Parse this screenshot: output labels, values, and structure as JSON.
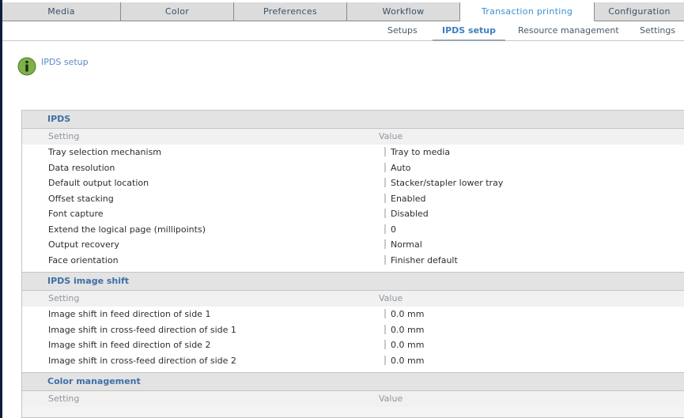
{
  "tabs": [
    "Media",
    "Color",
    "Preferences",
    "Workflow",
    "Transaction printing",
    "Configuration"
  ],
  "active_tab": "Transaction printing",
  "subtabs": [
    "Setups",
    "IPDS setup",
    "Resource management",
    "Settings"
  ],
  "active_subtab": "IPDS setup",
  "page_title": "IPDS setup",
  "sections": [
    {
      "title": "IPDS",
      "col_setting": "Setting",
      "col_value": "Value",
      "rows": [
        {
          "setting": "Tray selection mechanism",
          "value": "Tray to media"
        },
        {
          "setting": "Data resolution",
          "value": "Auto"
        },
        {
          "setting": "Default output location",
          "value": "Stacker/stapler lower tray"
        },
        {
          "setting": "Offset stacking",
          "value": "Enabled"
        },
        {
          "setting": "Font capture",
          "value": "Disabled"
        },
        {
          "setting": "Extend the logical page (millipoints)",
          "value": "0"
        },
        {
          "setting": "Output recovery",
          "value": "Normal"
        },
        {
          "setting": "Face orientation",
          "value": "Finisher default"
        }
      ]
    },
    {
      "title": "IPDS image shift",
      "col_setting": "Setting",
      "col_value": "Value",
      "rows": [
        {
          "setting": "Image shift in feed direction of side 1",
          "value": "0.0 mm"
        },
        {
          "setting": "Image shift in cross-feed direction of side 1",
          "value": "0.0 mm"
        },
        {
          "setting": "Image shift in feed direction of side 2",
          "value": "0.0 mm"
        },
        {
          "setting": "Image shift in cross-feed direction of side 2",
          "value": "0.0 mm"
        }
      ]
    },
    {
      "title": "Color management",
      "col_setting": "Setting",
      "col_value": "Value",
      "rows": []
    }
  ],
  "colors": {
    "accent": "#3b8fd1",
    "section_title": "#3f6fa6",
    "tab_bg": "#dcdcdc",
    "left_bar": "#0d1f3a"
  },
  "icons": {
    "page_icon": "info-icon"
  }
}
